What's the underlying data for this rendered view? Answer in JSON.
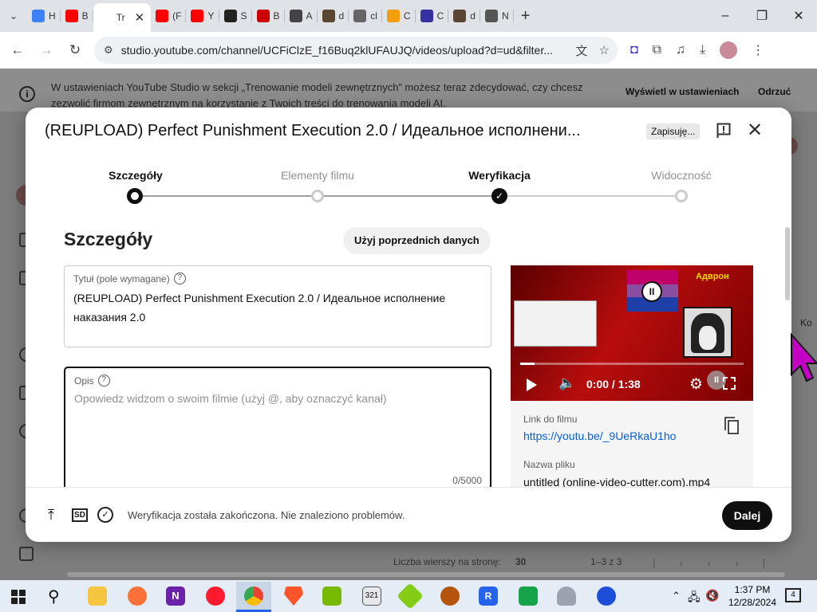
{
  "browser": {
    "tabs": [
      {
        "label": "H",
        "color": "#3b82f6"
      },
      {
        "label": "B",
        "color": "#ff0000"
      },
      {
        "label": "Tr",
        "color": "#ffffff",
        "active": true
      },
      {
        "label": "(F",
        "color": "#ff0000"
      },
      {
        "label": "Y",
        "color": "#ff0000"
      },
      {
        "label": "S",
        "color": "#222222"
      },
      {
        "label": "B",
        "color": "#cc0000"
      },
      {
        "label": "A",
        "color": "#444444"
      },
      {
        "label": "d",
        "color": "#5a4632"
      },
      {
        "label": "cl",
        "color": "#666666"
      },
      {
        "label": "C",
        "color": "#f59e0b"
      },
      {
        "label": "C",
        "color": "#3730a3"
      },
      {
        "label": "d",
        "color": "#5a4632"
      },
      {
        "label": "N",
        "color": "#555555"
      }
    ],
    "url": "studio.youtube.com/channel/UCFiClzE_f16Buq2klUFAUJQ/videos/upload?d=ud&filter..."
  },
  "background": {
    "banner_text": "W ustawieniach YouTube Studio w sekcji „Trenowanie modeli zewnętrznych” możesz teraz zdecydować, czy chcesz zezwolić firmom zewnętrznym na korzystanie z Twoich treści do trenowania modeli AI.",
    "banner_show": "Wyświetl w ustawieniach",
    "banner_dismiss": "Odrzuć",
    "rows_per_page_label": "Liczba wierszy na stronę:",
    "rows_per_page_value": "30",
    "range": "1–3 z 3",
    "right_edge_text": "Ko"
  },
  "modal": {
    "title": "(REUPLOAD) Perfect Punishment Execution 2.0 / Идеальное исполнени...",
    "saving": "Zapisuję...",
    "steps": [
      {
        "label": "Szczegóły",
        "state": "current"
      },
      {
        "label": "Elementy filmu",
        "state": "pending"
      },
      {
        "label": "Weryfikacja",
        "state": "done"
      },
      {
        "label": "Widoczność",
        "state": "pending"
      }
    ],
    "section_title": "Szczegóły",
    "reuse_button": "Użyj poprzednich danych",
    "title_field": {
      "label": "Tytuł (pole wymagane)",
      "value": "(REUPLOAD) Perfect Punishment Execution 2.0 / Идеальное исполнение наказания 2.0"
    },
    "description_field": {
      "label": "Opis",
      "placeholder": "Opowiedz widzom o swoim filmie (użyj @, aby oznaczyć kanał)",
      "counter": "0/5000"
    },
    "video": {
      "time": "0:00 / 1:38",
      "overlay_text": "Адврон"
    },
    "info": {
      "link_label": "Link do filmu",
      "link": "https://youtu.be/_9UeRkaU1ho",
      "filename_label": "Nazwa pliku",
      "filename": "untitled (online-video-cutter.com).mp4"
    },
    "footer": {
      "sd_badge": "SD",
      "status": "Weryfikacja została zakończona. Nie znaleziono problemów.",
      "next": "Dalej"
    }
  },
  "taskbar": {
    "time": "1:37 PM",
    "date": "12/28/2024",
    "notifications": "4"
  }
}
